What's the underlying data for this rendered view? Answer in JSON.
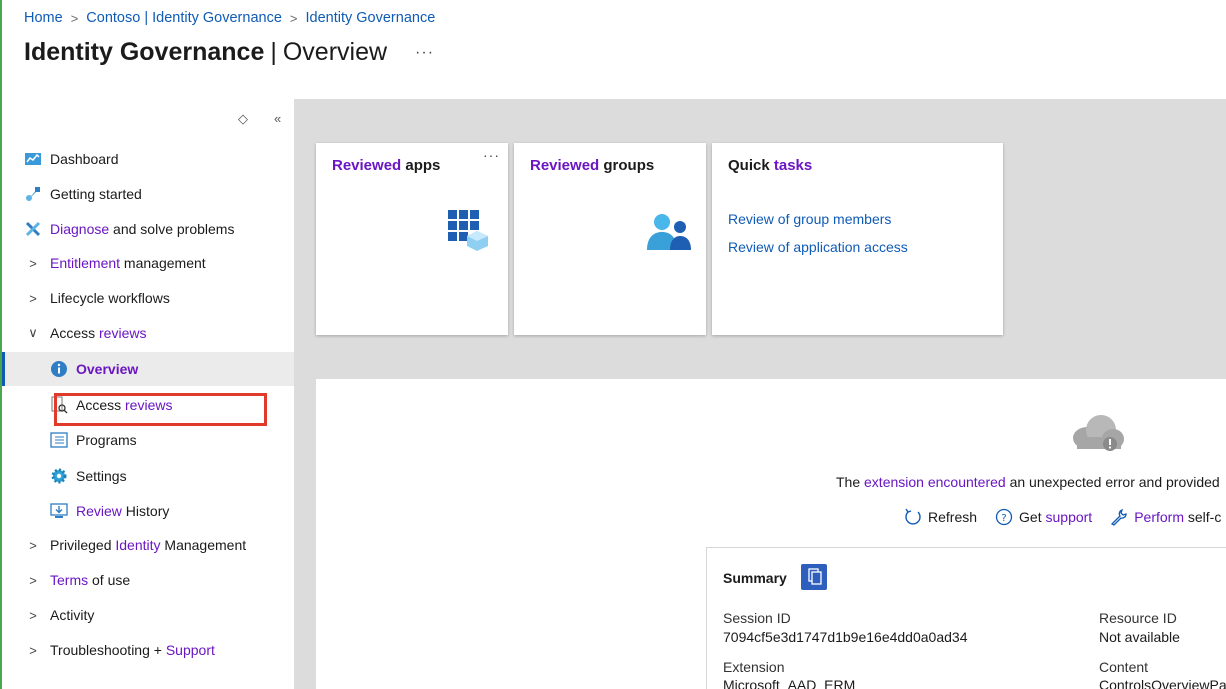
{
  "breadcrumb": [
    "Home",
    "Contoso | Identity Governance",
    "Identity Governance"
  ],
  "title": {
    "main": "Identity Governance",
    "sub": "Overview",
    "more": "···"
  },
  "sidebar": {
    "ctrl_up": "◇",
    "ctrl_collapse": "«",
    "items": [
      {
        "pre": "",
        "accent": "",
        "post": "Dashboard"
      },
      {
        "pre": "",
        "accent": "",
        "post": "Getting started"
      },
      {
        "pre": "",
        "accent": "Diagnose",
        "post": " and solve problems"
      },
      {
        "pre": "",
        "accent": "Entitlement",
        "post": " management"
      },
      {
        "pre": "",
        "accent": "",
        "post": "Lifecycle workflows"
      },
      {
        "pre": "Access ",
        "accent": "reviews",
        "post": ""
      },
      {
        "pre": "",
        "accent": "Overview",
        "post": ""
      },
      {
        "pre": "Access ",
        "accent": "reviews",
        "post": ""
      },
      {
        "pre": "",
        "accent": "",
        "post": "Programs"
      },
      {
        "pre": "",
        "accent": "",
        "post": "Settings"
      },
      {
        "pre": "",
        "accent": "Review",
        "post": " History"
      },
      {
        "pre": "Privileged ",
        "accent": "Identity",
        "post": " Management"
      },
      {
        "pre": "",
        "accent": "Terms",
        "post": " of use"
      },
      {
        "pre": "",
        "accent": "",
        "post": "Activity"
      },
      {
        "pre": "Troubleshooting + ",
        "accent": "Support",
        "post": ""
      }
    ]
  },
  "cards": {
    "apps": {
      "accent": "Reviewed",
      "rest": " apps",
      "more": "···"
    },
    "groups": {
      "accent": "Reviewed",
      "rest": " groups"
    },
    "quick": {
      "pre": "Quick ",
      "accent": "tasks",
      "links": [
        "Review of group members",
        "Review of application access"
      ]
    }
  },
  "error": {
    "pre": "The ",
    "accent": "extension encountered",
    "post": " an unexpected error and provided",
    "refresh": "Refresh",
    "get_pre": "Get ",
    "get_accent": "support",
    "perform_accent": "Perform",
    "perform_post": " self-c"
  },
  "summary": {
    "title": "Summary",
    "session_label": "Session ID",
    "session_value": "7094cf5e3d1747d1b9e16e4dd0a0ad34",
    "resource_label": "Resource ID",
    "resource_value": "Not available",
    "extension_label": "Extension",
    "extension_value": "Microsoft_AAD_ERM",
    "content_label": "Content",
    "content_value": "ControlsOverviewPa"
  },
  "colors": {
    "link": "#0f5bb5",
    "accent": "#6a16c2",
    "highlight_box": "#e03a2a",
    "panel_bg": "#dcdcdc"
  }
}
